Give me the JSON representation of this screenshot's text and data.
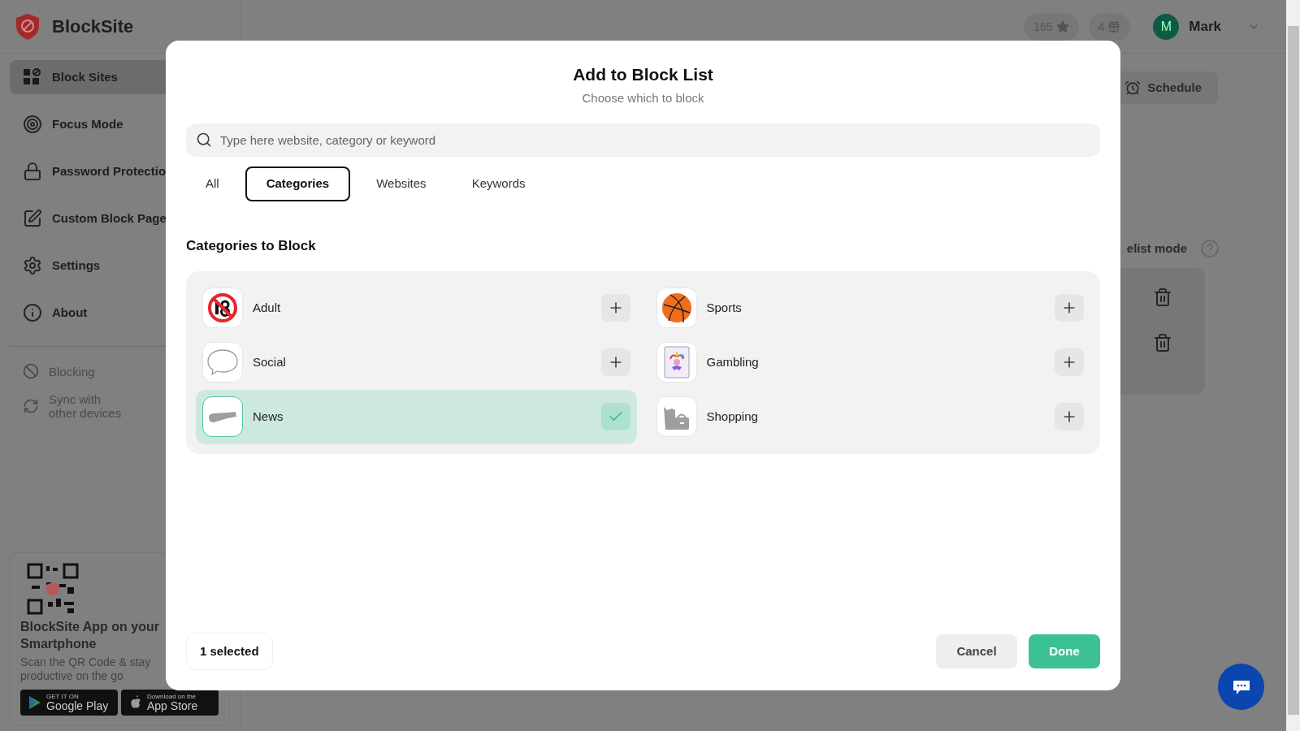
{
  "app": {
    "name": "BlockSite"
  },
  "header": {
    "points": "165",
    "gifts": "4",
    "avatar_letter": "M",
    "user_name": "Mark"
  },
  "sidebar": {
    "items": [
      {
        "label": "Block Sites",
        "selected": true
      },
      {
        "label": "Focus Mode",
        "selected": false
      },
      {
        "label": "Password Protectio",
        "selected": false
      },
      {
        "label": "Custom Block Page",
        "selected": false
      },
      {
        "label": "Settings",
        "selected": false
      },
      {
        "label": "About",
        "selected": false
      }
    ],
    "secondary_items": [
      "Blocking",
      "Sync with other devices"
    ],
    "promo": {
      "title": "BlockSite App on your Smartphone",
      "text": "Scan the QR Code & stay productive on the go",
      "badges": [
        {
          "small": "GET IT ON",
          "big": "Google Play"
        },
        {
          "small": "Download on the",
          "big": "App Store"
        }
      ]
    }
  },
  "main": {
    "schedule_button": "Schedule",
    "mode_label": "elist mode"
  },
  "dialog": {
    "title": "Add to Block List",
    "subtitle": "Choose which to block",
    "search": {
      "placeholder": "Type here website, category or keyword"
    },
    "tabs": [
      {
        "label": "All",
        "selected": false
      },
      {
        "label": "Categories",
        "selected": true
      },
      {
        "label": "Websites",
        "selected": false
      },
      {
        "label": "Keywords",
        "selected": false
      }
    ],
    "section_title": "Categories to Block",
    "categories": [
      {
        "label": "Adult",
        "selected": false
      },
      {
        "label": "Sports",
        "selected": false
      },
      {
        "label": "Social",
        "selected": false
      },
      {
        "label": "Gambling",
        "selected": false
      },
      {
        "label": "News",
        "selected": true
      },
      {
        "label": "Shopping",
        "selected": false
      }
    ],
    "selected_count": "1 selected",
    "buttons": [
      "Cancel",
      "Done"
    ]
  }
}
